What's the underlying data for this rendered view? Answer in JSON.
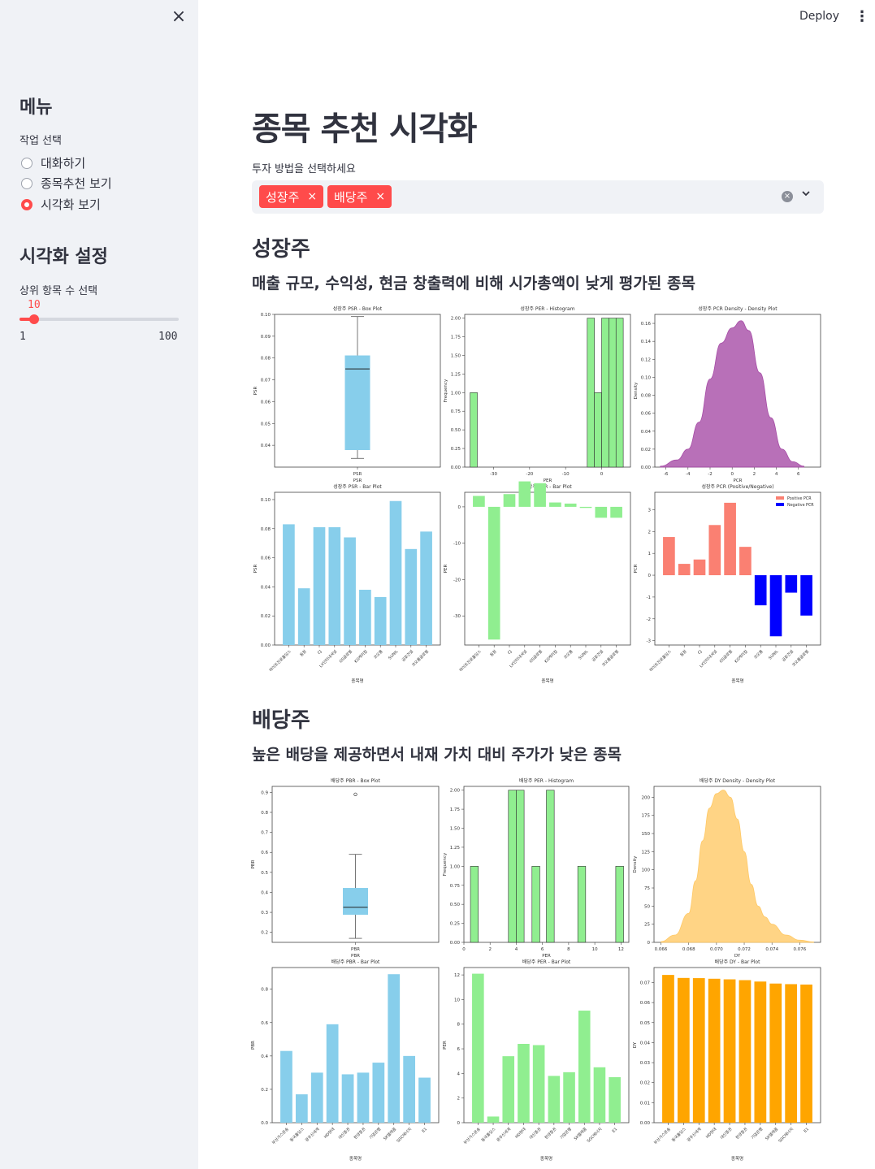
{
  "sidebar": {
    "close_icon": "×",
    "menu_title": "메뉴",
    "task_label": "작업 선택",
    "options": [
      "대화하기",
      "종목추천 보기",
      "시각화 보기"
    ],
    "selected_index": 2,
    "viz_settings_title": "시각화 설정",
    "slider": {
      "label": "상위 항목 수 선택",
      "value": "10",
      "min": "1",
      "max": "100",
      "value_fraction": 0.09
    }
  },
  "header": {
    "deploy_label": "Deploy",
    "menu_icon": "⋮"
  },
  "main": {
    "title": "종목 추천 시각화",
    "select_label": "투자 방법을 선택하세요",
    "selected_tags": [
      "성장주",
      "배당주"
    ],
    "tag_remove": "×",
    "clear_icon": "×",
    "chevron_icon": "⌄",
    "sections": [
      {
        "heading": "성장주",
        "description": "매출 규모, 수익성, 현금 창출력에 비해 시가총액이 낮게 평가된 종목"
      },
      {
        "heading": "배당주",
        "description": "높은 배당을 제공하면서 내재 가치 대비 주가가 낮은 종목"
      }
    ]
  },
  "colors": {
    "accent": "#ff4b4b",
    "sky": "#87ceeb",
    "green": "#90ee90",
    "purple": "#a64ca6",
    "salmon": "#fa8072",
    "blue": "#0000ff",
    "orange": "#ffa500",
    "light_orange": "#ffc966"
  },
  "chart_data": [
    {
      "id": "g_box",
      "type": "box",
      "title": "성장주 PSR - Box Plot",
      "xlabel": "PSR",
      "ylabel": "PSR",
      "ylim": [
        0.03,
        0.1
      ],
      "yticks": [
        "0.04",
        "0.05",
        "0.06",
        "0.07",
        "0.08",
        "0.09",
        "0.10"
      ],
      "stats": {
        "min": 0.034,
        "q1": 0.038,
        "median": 0.075,
        "q3": 0.081,
        "max": 0.099
      },
      "color": "#87ceeb"
    },
    {
      "id": "g_hist",
      "type": "histogram",
      "title": "성장주 PER - Histogram",
      "xlabel": "PER",
      "ylabel": "Frequency",
      "xlim": [
        -38,
        8
      ],
      "ylim": [
        0,
        2.05
      ],
      "xticks": [
        "-30",
        "-20",
        "-10",
        "0"
      ],
      "yticks": [
        "0.00",
        "0.25",
        "0.50",
        "0.75",
        "1.00",
        "1.25",
        "1.50",
        "1.75",
        "2.00"
      ],
      "bins": [
        {
          "x0": -36.5,
          "x1": -34.5,
          "count": 1
        },
        {
          "x0": -4,
          "x1": -2,
          "count": 2
        },
        {
          "x0": -2,
          "x1": 0,
          "count": 1
        },
        {
          "x0": 0,
          "x1": 2,
          "count": 2
        },
        {
          "x0": 2,
          "x1": 4,
          "count": 2
        },
        {
          "x0": 4,
          "x1": 6,
          "count": 2
        }
      ],
      "color": "#90ee90"
    },
    {
      "id": "g_kde",
      "type": "density",
      "title": "성장주 PCR Density - Density Plot",
      "xlabel": "PCR",
      "ylabel": "Density",
      "xlim": [
        -7,
        8
      ],
      "ylim": [
        0,
        0.17
      ],
      "xticks": [
        "-6",
        "-4",
        "-2",
        "0",
        "2",
        "4",
        "6"
      ],
      "yticks": [
        "0.00",
        "0.02",
        "0.04",
        "0.06",
        "0.08",
        "0.10",
        "0.12",
        "0.14",
        "0.16"
      ],
      "x": [
        -6.5,
        -5,
        -4,
        -3,
        -2,
        -1,
        0,
        0.8,
        1.5,
        2.5,
        3.5,
        4.5,
        5.5,
        6.5
      ],
      "y": [
        0.001,
        0.008,
        0.02,
        0.05,
        0.098,
        0.138,
        0.155,
        0.163,
        0.152,
        0.105,
        0.055,
        0.02,
        0.006,
        0.001
      ],
      "color": "#a64ca6"
    },
    {
      "id": "g_psr_bar",
      "type": "bar",
      "title": "성장주 PSR - Bar Plot",
      "xlabel": "종목명",
      "ylabel": "PSR",
      "ylim": [
        0,
        0.105
      ],
      "yticks": [
        "0.00",
        "0.02",
        "0.04",
        "0.06",
        "0.08",
        "0.10"
      ],
      "categories": [
        "하이트진로홀딩스",
        "동원",
        "CJ",
        "LX인터내셔널",
        "GS글로벌",
        "KG케미칼",
        "코오롱",
        "SUNIL",
        "금호건설",
        "코오롱글로벌"
      ],
      "values": [
        0.083,
        0.039,
        0.081,
        0.081,
        0.074,
        0.038,
        0.033,
        0.099,
        0.066,
        0.078
      ],
      "color": "#87ceeb"
    },
    {
      "id": "g_per_bar",
      "type": "bar",
      "title": "성장주 PER - Bar Plot",
      "xlabel": "종목명",
      "ylabel": "PER",
      "ylim": [
        -38,
        4
      ],
      "yticks": [
        "-30",
        "-20",
        "-10",
        "0"
      ],
      "categories": [
        "하이트진로홀딩스",
        "동원",
        "CJ",
        "LX인터내셔널",
        "GS글로벌",
        "KG케미칼",
        "코오롱",
        "SUNIL",
        "금호건설",
        "코오롱글로벌"
      ],
      "values": [
        3,
        -36.5,
        3.5,
        7,
        6.5,
        1.2,
        0.9,
        -0.3,
        -3,
        -3
      ],
      "color": "#90ee90"
    },
    {
      "id": "g_pcr_bar",
      "type": "posneg",
      "title": "성장주 PCR (Positive/Negative)",
      "xlabel": "종목명",
      "ylabel": "PCR",
      "ylim": [
        -3.2,
        3.8
      ],
      "yticks": [
        "-3",
        "-2",
        "-1",
        "0",
        "1",
        "2",
        "3"
      ],
      "legend": [
        "Positive PCR",
        "Negative PCR"
      ],
      "categories": [
        "하이트진로홀딩스",
        "동원",
        "CJ",
        "LX인터내셔널",
        "GS글로벌",
        "KG케미칼",
        "코오롱",
        "SUNIL",
        "금호건설",
        "코오롱글로벌"
      ],
      "values": [
        1.75,
        0.52,
        0.72,
        2.3,
        3.32,
        1.3,
        -1.38,
        -2.8,
        -0.8,
        -1.85
      ],
      "pos_color": "#fa8072",
      "neg_color": "#0000ff"
    },
    {
      "id": "d_box",
      "type": "box",
      "title": "배당주 PBR - Box Plot",
      "xlabel": "PBR",
      "ylabel": "PBR",
      "ylim": [
        0.15,
        0.93
      ],
      "yticks": [
        "0.2",
        "0.3",
        "0.4",
        "0.5",
        "0.6",
        "0.7",
        "0.8",
        "0.9"
      ],
      "stats": {
        "min": 0.17,
        "q1": 0.29,
        "median": 0.325,
        "q3": 0.42,
        "max": 0.59,
        "outliers": [
          0.89
        ]
      },
      "color": "#87ceeb"
    },
    {
      "id": "d_hist",
      "type": "histogram",
      "title": "배당주 PER - Histogram",
      "xlabel": "PER",
      "ylabel": "Frequency",
      "xlim": [
        0,
        12.6
      ],
      "ylim": [
        0,
        2.05
      ],
      "xticks": [
        "0",
        "2",
        "4",
        "6",
        "8",
        "10",
        "12"
      ],
      "yticks": [
        "0.00",
        "0.25",
        "0.50",
        "0.75",
        "1.00",
        "1.25",
        "1.50",
        "1.75",
        "2.00"
      ],
      "bins": [
        {
          "x0": 0.5,
          "x1": 1.1,
          "count": 1
        },
        {
          "x0": 3.4,
          "x1": 4.0,
          "count": 2
        },
        {
          "x0": 4.0,
          "x1": 4.6,
          "count": 2
        },
        {
          "x0": 5.2,
          "x1": 5.8,
          "count": 1
        },
        {
          "x0": 6.3,
          "x1": 6.9,
          "count": 2
        },
        {
          "x0": 8.7,
          "x1": 9.3,
          "count": 1
        },
        {
          "x0": 11.6,
          "x1": 12.2,
          "count": 1
        }
      ],
      "color": "#90ee90"
    },
    {
      "id": "d_kde",
      "type": "density",
      "title": "배당주 DY Density - Density Plot",
      "xlabel": "DY",
      "ylabel": "Density",
      "xlim": [
        0.0655,
        0.0775
      ],
      "ylim": [
        0,
        215
      ],
      "xticks": [
        "0.066",
        "0.068",
        "0.070",
        "0.072",
        "0.074",
        "0.076"
      ],
      "yticks": [
        "0",
        "25",
        "50",
        "75",
        "100",
        "125",
        "150",
        "175",
        "200"
      ],
      "x": [
        0.066,
        0.067,
        0.068,
        0.0685,
        0.069,
        0.0695,
        0.07,
        0.0705,
        0.071,
        0.0715,
        0.072,
        0.0725,
        0.073,
        0.0735,
        0.074,
        0.075,
        0.076,
        0.077
      ],
      "y": [
        1,
        10,
        40,
        85,
        140,
        185,
        205,
        210,
        200,
        170,
        125,
        80,
        50,
        35,
        25,
        10,
        3,
        0.5
      ],
      "color": "#ffc966"
    },
    {
      "id": "d_pbr_bar",
      "type": "bar",
      "title": "배당주 PBR - Bar Plot",
      "xlabel": "종목명",
      "ylabel": "PBR",
      "ylim": [
        0,
        0.93
      ],
      "yticks": [
        "0.0",
        "0.2",
        "0.4",
        "0.6",
        "0.8"
      ],
      "categories": [
        "부산가스운송",
        "동국홀딩스",
        "광주신세계",
        "HD현대",
        "대신증권",
        "한양증권",
        "기업은행",
        "SK텔레콤",
        "SGC에너지",
        "E1"
      ],
      "values": [
        0.43,
        0.17,
        0.3,
        0.59,
        0.29,
        0.3,
        0.36,
        0.89,
        0.4,
        0.27
      ],
      "color": "#87ceeb"
    },
    {
      "id": "d_per_bar",
      "type": "bar",
      "title": "배당주 PER - Bar Plot",
      "xlabel": "종목명",
      "ylabel": "PER",
      "ylim": [
        0,
        12.6
      ],
      "yticks": [
        "0",
        "2",
        "4",
        "6",
        "8",
        "10",
        "12"
      ],
      "categories": [
        "부산가스운송",
        "동국홀딩스",
        "광주신세계",
        "HD현대",
        "대신증권",
        "한양증권",
        "기업은행",
        "SK텔레콤",
        "SGC에너지",
        "E1"
      ],
      "values": [
        12.1,
        0.5,
        5.4,
        6.4,
        6.3,
        3.8,
        4.1,
        9.1,
        4.5,
        3.7
      ],
      "color": "#90ee90"
    },
    {
      "id": "d_dy_bar",
      "type": "bar",
      "title": "배당주 DY - Bar Plot",
      "xlabel": "종목명",
      "ylabel": "DY",
      "ylim": [
        0,
        0.0775
      ],
      "yticks": [
        "0.00",
        "0.01",
        "0.02",
        "0.03",
        "0.04",
        "0.05",
        "0.06",
        "0.07"
      ],
      "categories": [
        "부산가스운송",
        "동국홀딩스",
        "광주신세계",
        "HD현대",
        "대신증권",
        "한양증권",
        "기업은행",
        "SK텔레콤",
        "SGC에너지",
        "E1"
      ],
      "values": [
        0.0738,
        0.0723,
        0.0722,
        0.0719,
        0.0716,
        0.0712,
        0.0705,
        0.0695,
        0.0692,
        0.069
      ],
      "color": "#ffa500"
    }
  ]
}
